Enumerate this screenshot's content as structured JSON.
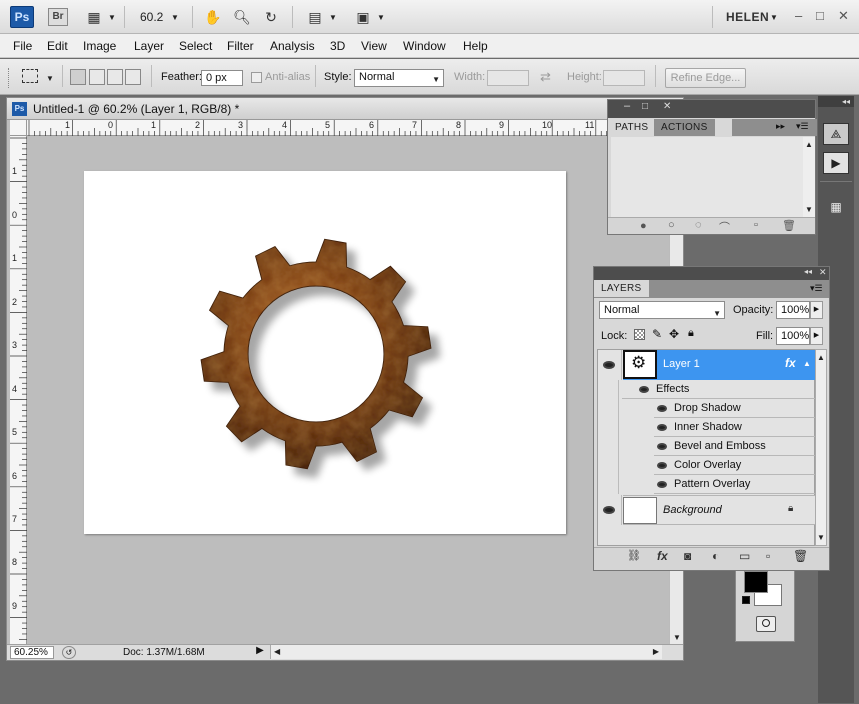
{
  "app": {
    "logo": "Ps",
    "bridge": "Br",
    "zoom_value": "60.2",
    "user": "HELEN"
  },
  "menu": [
    "File",
    "Edit",
    "Image",
    "Layer",
    "Select",
    "Filter",
    "Analysis",
    "3D",
    "View",
    "Window",
    "Help"
  ],
  "options": {
    "feather_label": "Feather:",
    "feather_value": "0 px",
    "antialias_label": "Anti-alias",
    "style_label": "Style:",
    "style_value": "Normal",
    "width_label": "Width:",
    "height_label": "Height:",
    "refine_label": "Refine Edge..."
  },
  "document": {
    "title": "Untitled-1 @ 60.2% (Layer 1, RGB/8) *",
    "zoom_pct": "60.25%",
    "doc_info": "Doc: 1.37M/1.68M",
    "ruler_top": [
      "1",
      "0",
      "1",
      "2",
      "3",
      "4",
      "5",
      "6",
      "7",
      "8",
      "9",
      "10",
      "11"
    ],
    "ruler_left": [
      "1",
      "0",
      "1",
      "2",
      "3",
      "4",
      "5",
      "6",
      "7",
      "8",
      "9"
    ]
  },
  "paths_panel": {
    "tabs": [
      "PATHS",
      "ACTIONS"
    ]
  },
  "layers_panel": {
    "tab": "LAYERS",
    "blend_mode": "Normal",
    "opacity_label": "Opacity:",
    "opacity_value": "100%",
    "lock_label": "Lock:",
    "fill_label": "Fill:",
    "fill_value": "100%",
    "layers": [
      {
        "name": "Layer 1",
        "fx": "fx",
        "selected": true
      },
      {
        "name": "Background",
        "selected": false
      }
    ],
    "effects_label": "Effects",
    "effects": [
      "Drop Shadow",
      "Inner Shadow",
      "Bevel and Emboss",
      "Color Overlay",
      "Pattern Overlay"
    ]
  },
  "colors": {
    "selected_layer": "#3d95f0",
    "gear_rust": "#7a3e12",
    "ps_blue": "#1d5aa8"
  }
}
